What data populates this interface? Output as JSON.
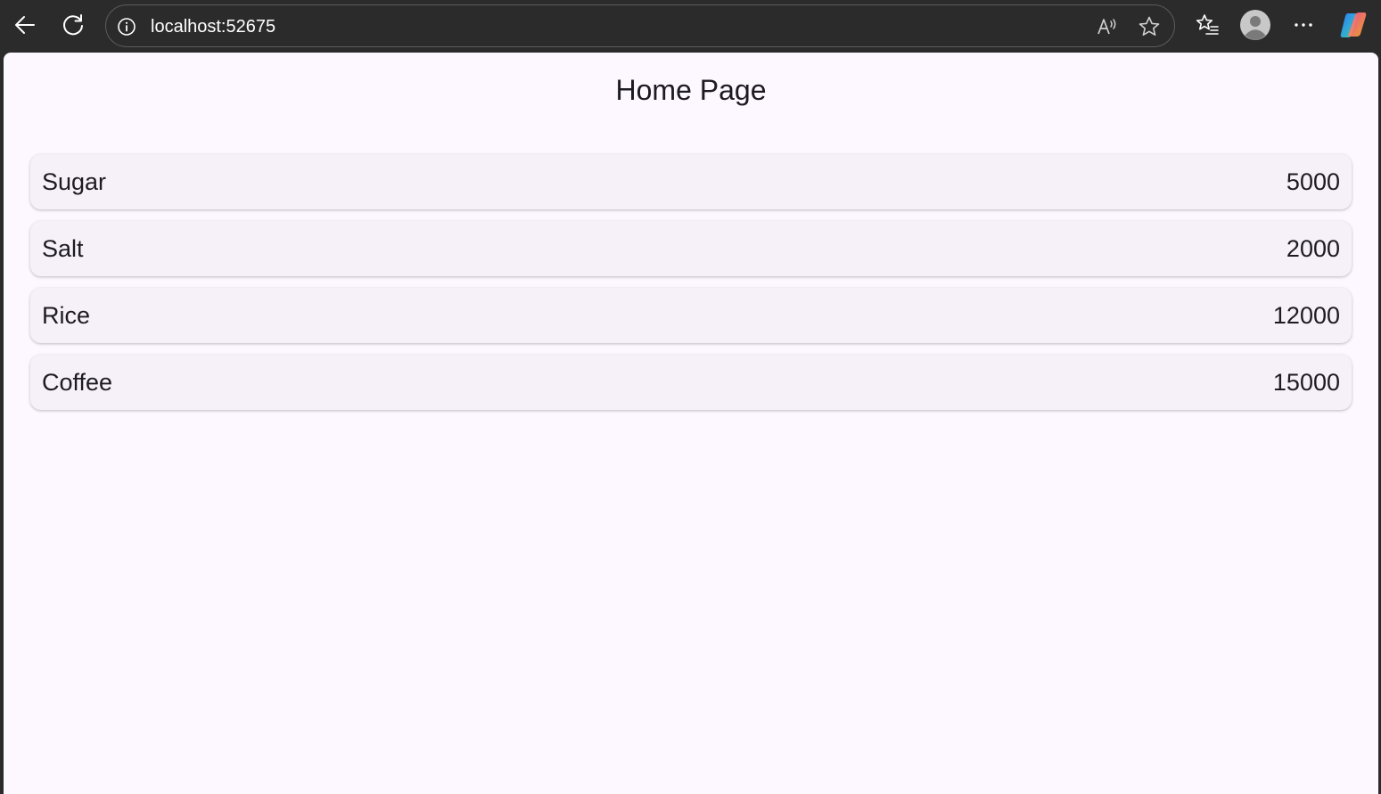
{
  "browser": {
    "url": "localhost:52675",
    "icons": {
      "back": "arrow-left-icon",
      "refresh": "refresh-icon",
      "site_info": "info-icon",
      "read_aloud": "read-aloud-icon",
      "favorite": "star-icon",
      "favorites_list": "favorites-list-icon",
      "profile": "profile-avatar-icon",
      "more": "more-dots-icon",
      "copilot": "copilot-icon"
    }
  },
  "page": {
    "title": "Home Page",
    "items": [
      {
        "name": "Sugar",
        "value": "5000"
      },
      {
        "name": "Salt",
        "value": "2000"
      },
      {
        "name": "Rice",
        "value": "12000"
      },
      {
        "name": "Coffee",
        "value": "15000"
      }
    ]
  },
  "colors": {
    "chrome": "#2b2b2b",
    "page_bg": "#fdf7ff",
    "card_bg": "#f6f1f8",
    "text": "#1d1b20"
  }
}
